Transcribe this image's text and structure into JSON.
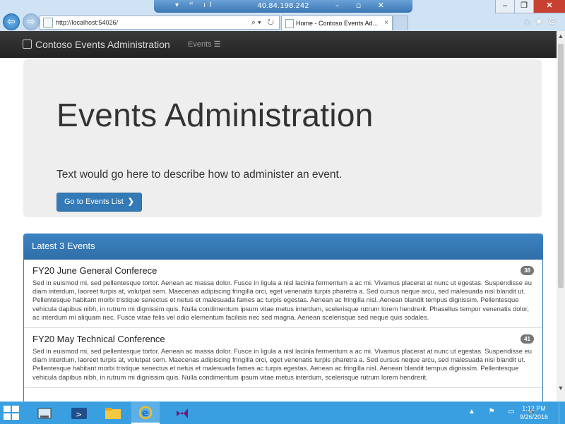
{
  "browser": {
    "rdp_ip": "40.84.198.242",
    "address_url": "http://localhost:54026/",
    "tab_title": "Home - Contoso Events Ad...",
    "tab_close": "×"
  },
  "navbar": {
    "brand": "Contoso Events Administration",
    "events_link": "Events"
  },
  "jumbotron": {
    "title": "Events Administration",
    "lead": "Text would go here to describe how to administer an event.",
    "button_label": "Go to Events List"
  },
  "panel": {
    "heading": "Latest 3 Events",
    "items": [
      {
        "title": "FY20 June General Conferece",
        "count": "38",
        "body": "Sed in euismod mi, sed pellentesque tortor. Aenean ac massa dolor. Fusce in ligula a nisl lacinia fermentum a ac mi. Vivamus placerat at nunc ut egestas. Suspendisse eu diam interdum, laoreet turpis at, volutpat sem. Maecenas adipiscing fringilla orci, eget venenatis turpis pharetra a. Sed cursus neque arcu, sed malesuada nisl blandit ut. Pellentesque habitant morbi tristique senectus et netus et malesuada fames ac turpis egestas. Aenean ac fringilla nisl. Aenean blandit tempus dignissim. Pellentesque vehicula dapibus nibh, in rutrum mi dignissim quis. Nulla condimentum ipsum vitae metus interdum, scelerisque rutrum lorem hendrerit. Phasellus tempor venenatis dolor, ac interdum mi aliquam nec. Fusce vitae felis vel odio elementum facilisis nec sed magna. Aenean scelerisque sed neque quis sodales."
      },
      {
        "title": "FY20 May Technical Conference",
        "count": "41",
        "body": "Sed in euismod mi, sed pellentesque tortor. Aenean ac massa dolor. Fusce in ligula a nisl lacinia fermentum a ac mi. Vivamus placerat at nunc ut egestas. Suspendisse eu diam interdum, laoreet turpis at, volutpat sem. Maecenas adipiscing fringilla orci, eget venenatis turpis pharetra a. Sed cursus neque arcu, sed malesuada nisl blandit ut. Pellentesque habitant morbi tristique senectus et netus et malesuada fames ac turpis egestas. Aenean ac fringilla nisl. Aenean blandit tempus dignissim. Pellentesque vehicula dapibus nibh, in rutrum mi dignissim quis. Nulla condimentum ipsum vitae metus interdum, scelerisque rutrum lorem hendrerit."
      }
    ]
  },
  "taskbar": {
    "time": "1:12 PM",
    "date": "9/26/2016",
    "colors": {
      "bar": "#3a9fe0",
      "accent": "#337ab7"
    }
  }
}
